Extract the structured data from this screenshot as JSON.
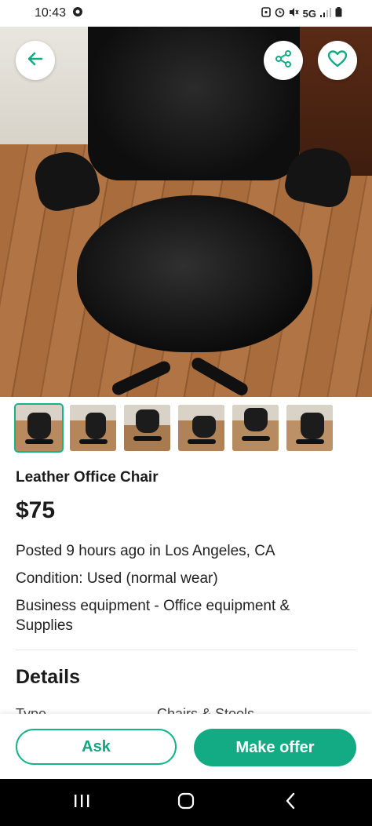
{
  "status_bar": {
    "time": "10:43",
    "network": "5G"
  },
  "hero": {
    "back_icon": "arrow-left-icon",
    "share_icon": "share-icon",
    "favorite_icon": "heart-icon"
  },
  "thumbnails": [
    {
      "label": "photo-1",
      "selected": true
    },
    {
      "label": "photo-2",
      "selected": false
    },
    {
      "label": "photo-3",
      "selected": false
    },
    {
      "label": "photo-4",
      "selected": false
    },
    {
      "label": "photo-5",
      "selected": false
    },
    {
      "label": "photo-6",
      "selected": false
    }
  ],
  "listing": {
    "title": "Leather Office Chair",
    "price": "$75",
    "posted": "Posted 9 hours ago in Los Angeles, CA",
    "condition": "Condition: Used (normal wear)",
    "category": "Business equipment - Office equipment & Supplies"
  },
  "details": {
    "heading": "Details",
    "type_label": "Type",
    "type_value": "Chairs & Stools"
  },
  "actions": {
    "ask_label": "Ask",
    "offer_label": "Make offer"
  },
  "colors": {
    "accent": "#12ab83",
    "accent_text": "#14a37f"
  }
}
